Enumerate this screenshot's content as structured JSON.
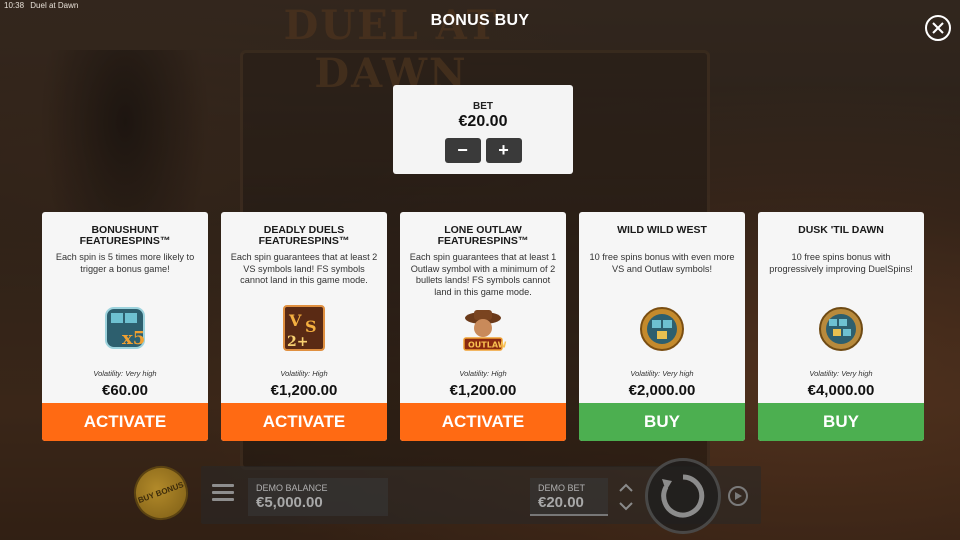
{
  "status_bar": {
    "time": "10:38",
    "app_title": "Duel at Dawn"
  },
  "background": {
    "logo_text": "DUEL AT DAWN"
  },
  "dialog": {
    "title": "BONUS BUY",
    "close_icon": "close-icon"
  },
  "bet": {
    "label": "BET",
    "value": "€20.00",
    "decrease": "−",
    "increase": "+"
  },
  "cards": [
    {
      "title": "BONUSHUNT FEATURESPINS™",
      "description": "Each spin is 5 times more likely to trigger a bonus game!",
      "icon": "bonushunt-x5-icon",
      "volatility": "Volatility: Very high",
      "price": "€60.00",
      "action": "ACTIVATE",
      "action_color": "#ff6a13"
    },
    {
      "title": "DEADLY DUELS FEATURESPINS™",
      "description": "Each spin guarantees that at least 2 VS symbols land! FS symbols cannot land in this game mode.",
      "icon": "deadly-duels-2vs-icon",
      "volatility": "Volatility: High",
      "price": "€1,200.00",
      "action": "ACTIVATE",
      "action_color": "#ff6a13"
    },
    {
      "title": "LONE OUTLAW FEATURESPINS™",
      "description": "Each spin guarantees that at least 1 Outlaw symbol with a minimum of 2 bullets lands! FS symbols cannot land in this game mode.",
      "icon": "outlaw-icon",
      "volatility": "Volatility: High",
      "price": "€1,200.00",
      "action": "ACTIVATE",
      "action_color": "#ff6a13"
    },
    {
      "title": "WILD WILD WEST",
      "description": "10 free spins bonus with even more VS and Outlaw symbols!",
      "icon": "wild-wild-west-icon",
      "volatility": "Volatility: Very high",
      "price": "€2,000.00",
      "action": "BUY",
      "action_color": "#4caf50"
    },
    {
      "title": "DUSK 'TIL DAWN",
      "description": "10 free spins bonus with progressively improving DuelSpins!",
      "icon": "dusk-til-dawn-icon",
      "volatility": "Volatility: Very high",
      "price": "€4,000.00",
      "action": "BUY",
      "action_color": "#4caf50"
    }
  ],
  "bottom_bar": {
    "buy_bonus": "BUY BONUS",
    "demo_balance_label": "DEMO BALANCE",
    "demo_balance_value": "€5,000.00",
    "demo_bet_label": "DEMO BET",
    "demo_bet_value": "€20.00"
  }
}
